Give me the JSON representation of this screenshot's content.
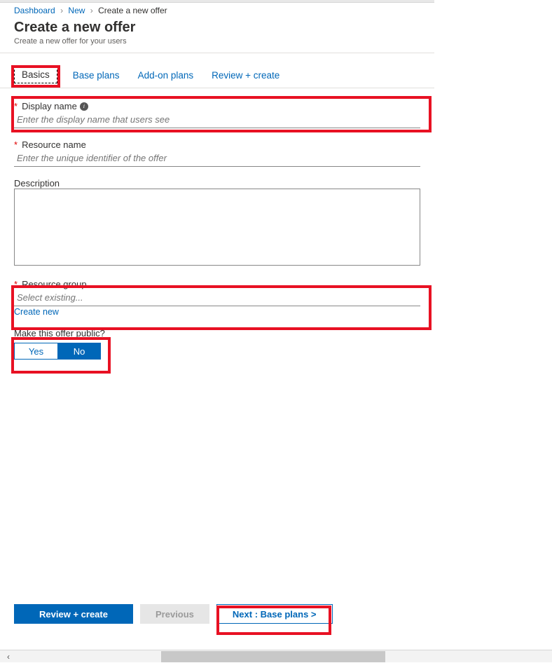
{
  "breadcrumb": {
    "items": [
      "Dashboard",
      "New",
      "Create a new offer"
    ]
  },
  "header": {
    "title": "Create a new offer",
    "subtitle": "Create a new offer for your users"
  },
  "tabs": {
    "items": [
      "Basics",
      "Base plans",
      "Add-on plans",
      "Review + create"
    ],
    "active_index": 0
  },
  "form": {
    "display_name": {
      "label": "Display name",
      "required": true,
      "has_info": true,
      "placeholder": "Enter the display name that users see"
    },
    "resource_name": {
      "label": "Resource name",
      "required": true,
      "placeholder": "Enter the unique identifier of the offer"
    },
    "description": {
      "label": "Description",
      "required": false
    },
    "resource_group": {
      "label": "Resource group",
      "required": true,
      "placeholder": "Select existing...",
      "create_new": "Create new"
    },
    "public_toggle": {
      "label": "Make this offer public?",
      "yes": "Yes",
      "no": "No",
      "selected": "No"
    }
  },
  "footer": {
    "review": "Review + create",
    "previous": "Previous",
    "next": "Next : Base plans >"
  }
}
